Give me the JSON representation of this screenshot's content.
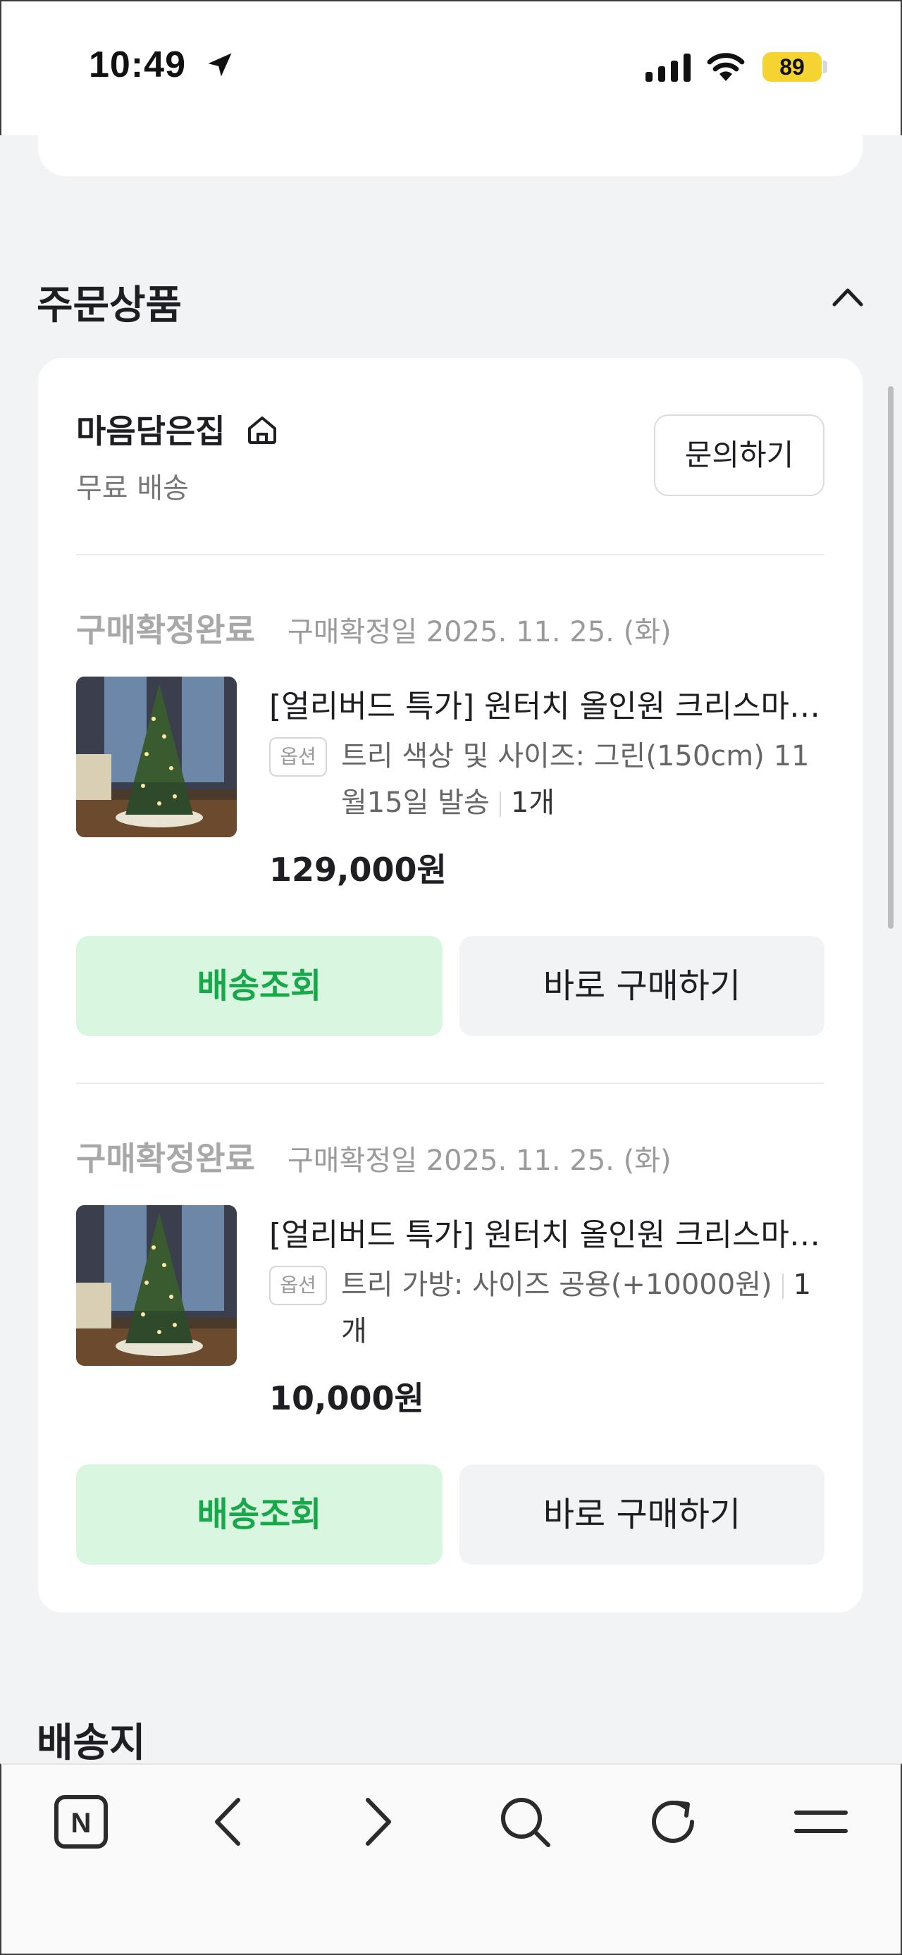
{
  "status_bar": {
    "time": "10:49",
    "battery_level": "89",
    "icons": [
      "location-arrow-icon",
      "cellular-signal-icon",
      "wifi-icon",
      "battery-icon"
    ]
  },
  "order_section": {
    "title": "주문상품",
    "collapse_icon": "chevron-up-icon",
    "store": {
      "name": "마음담은집",
      "icon": "home-icon",
      "shipping": "무료 배송",
      "inquiry_label": "문의하기"
    },
    "items": [
      {
        "status": "구매확정완료",
        "confirm_date": "구매확정일 2025. 11. 25. (화)",
        "title": "[얼리버드 특가] 원터치 올인원 크리스마스 트리",
        "option_badge": "옵션",
        "option_text": "트리 색상 및 사이즈: 그린(150cm) 11월15일 발송",
        "quantity": "1개",
        "price": "129,000원",
        "track_label": "배송조회",
        "buy_label": "바로 구매하기"
      },
      {
        "status": "구매확정완료",
        "confirm_date": "구매확정일 2025. 11. 25. (화)",
        "title": "[얼리버드 특가] 원터치 올인원 크리스마스 트리",
        "option_badge": "옵션",
        "option_text": "트리 가방: 사이즈 공용(+10000원)",
        "quantity": "1개",
        "price": "10,000원",
        "track_label": "배송조회",
        "buy_label": "바로 구매하기"
      }
    ]
  },
  "shipping_section": {
    "title": "배송지"
  },
  "toolbar": {
    "buttons": [
      "naver-home-icon",
      "back-icon",
      "forward-icon",
      "search-icon",
      "reload-icon",
      "menu-icon"
    ],
    "home_letter": "N"
  },
  "colors": {
    "accent_green": "#17a84a",
    "track_button_bg": "#d8f6e0",
    "battery_yellow": "#f5d330",
    "page_bg": "#f2f3f5"
  }
}
